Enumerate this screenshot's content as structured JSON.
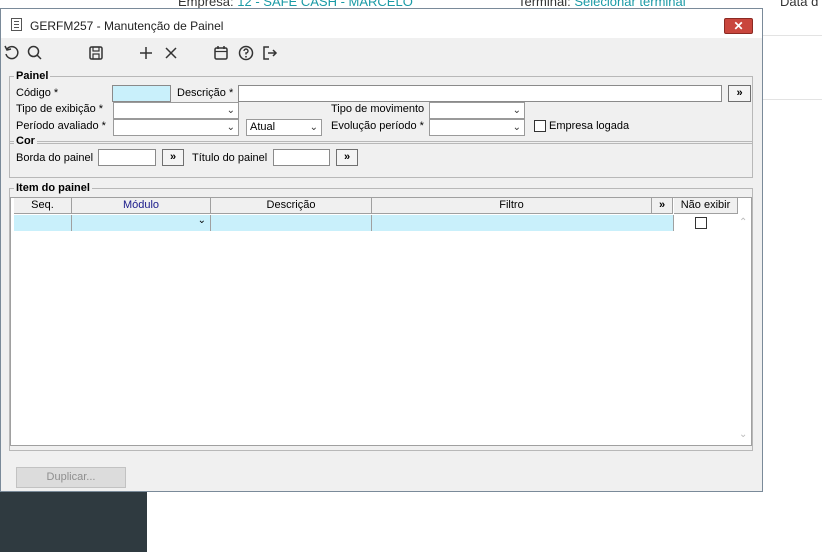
{
  "background": {
    "empresa_label": "Empresa:",
    "empresa_value": "12 - SAFE CASH - MARCELO",
    "terminal_label": "Terminal:",
    "terminal_value": "Selecionar terminal",
    "data_label": "Data d"
  },
  "dialog": {
    "title": "GERFM257 - Manutenção de Painel",
    "close_label": "✕"
  },
  "toolbar": {
    "icons": [
      "undo-icon",
      "search-icon",
      "save-icon",
      "add-icon",
      "delete-icon",
      "calendar-icon",
      "help-icon",
      "exit-icon"
    ]
  },
  "painel": {
    "legend": "Painel",
    "codigo_label": "Código *",
    "codigo_value": "",
    "descricao_label": "Descrição *",
    "descricao_value": "",
    "lookup_label": "»",
    "tipo_exibicao_label": "Tipo de exibição *",
    "tipo_exibicao_value": "",
    "tipo_movimento_label": "Tipo de movimento",
    "tipo_movimento_value": "",
    "periodo_label": "Período avaliado *",
    "periodo_value": "",
    "periodo_ref_value": "Atual",
    "evolucao_label": "Evolução período *",
    "evolucao_value": "",
    "empresa_logada_label": "Empresa logada"
  },
  "cor": {
    "legend": "Cor",
    "borda_label": "Borda do painel",
    "borda_value": "",
    "titulo_label": "Título do painel",
    "titulo_value": "",
    "picker_label": "»"
  },
  "item": {
    "legend": "Item do painel",
    "columns": [
      "Seq.",
      "Módulo",
      "Descrição",
      "Filtro",
      "»",
      "Não exibir"
    ]
  },
  "footer": {
    "duplicar_label": "Duplicar..."
  },
  "colors": {
    "accent_cell": "#c9f0fb",
    "close_red": "#c9463d",
    "link_teal": "#1a9aa6"
  }
}
